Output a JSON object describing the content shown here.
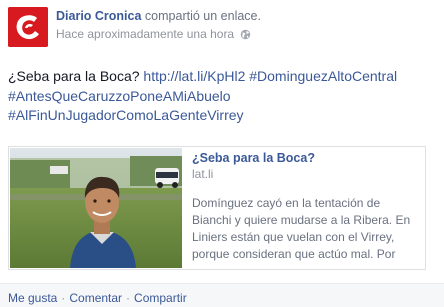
{
  "header": {
    "page_name": "Diario Cronica",
    "shared_text": "compartió un",
    "shared_link": "enlace.",
    "timestamp": "Hace aproximadamente una hora",
    "privacy_icon": "globe-icon",
    "avatar_icon": "cronica-logo"
  },
  "post": {
    "text_plain": "¿Seba para la Boca?",
    "url": "http://lat.li/KpHl2",
    "hashtag1": "#DominguezAltoCentral",
    "hashtag2": "#AntesQueCaruzzoPoneAMiAbuelo",
    "hashtag3": "#AlFinUnJugadorComoLaGenteVirrey"
  },
  "attachment": {
    "title": "¿Seba para la Boca?",
    "domain": "lat.li",
    "description": "Domínguez cayó en la tentación de Bianchi y quiere mudarse a la Ribera. En Liniers están que vuelan con el Virrey, porque consideran que actúo mal. Por"
  },
  "actions": {
    "like": "Me gusta",
    "comment": "Comentar",
    "share": "Compartir",
    "separator": "·"
  },
  "colors": {
    "link": "#3b5998",
    "brand_red": "#d71a20",
    "meta_gray": "#90949c"
  }
}
